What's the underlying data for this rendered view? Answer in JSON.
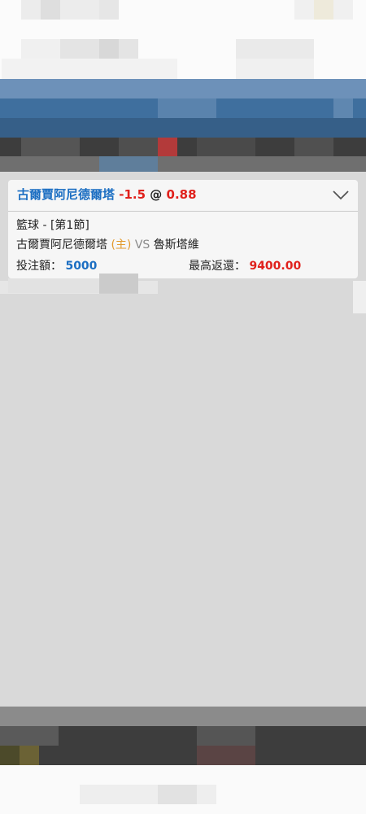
{
  "bet_card": {
    "selection": {
      "team": "古爾賈阿尼德爾塔",
      "handicap": "-1.5",
      "at_symbol": "@",
      "odds": "0.88"
    },
    "sport_period": "籃球 - [第1節]",
    "match": {
      "home_team": "古爾賈阿尼德爾塔",
      "home_marker": "(主)",
      "vs": "VS",
      "away_team": "魯斯塔維"
    },
    "stake_label": "投注額：",
    "stake_value": "5000",
    "max_return_label": "最高返還：",
    "max_return_value": "9400.00"
  },
  "colors": {
    "team_blue": "#1b6ec2",
    "odds_red": "#e0211c",
    "home_marker_orange": "#e39a2c",
    "overlay_gray": "#d9d9d9",
    "header_blue": "#3f6f9e"
  },
  "icons": {
    "expand": "chevron-down-icon"
  }
}
